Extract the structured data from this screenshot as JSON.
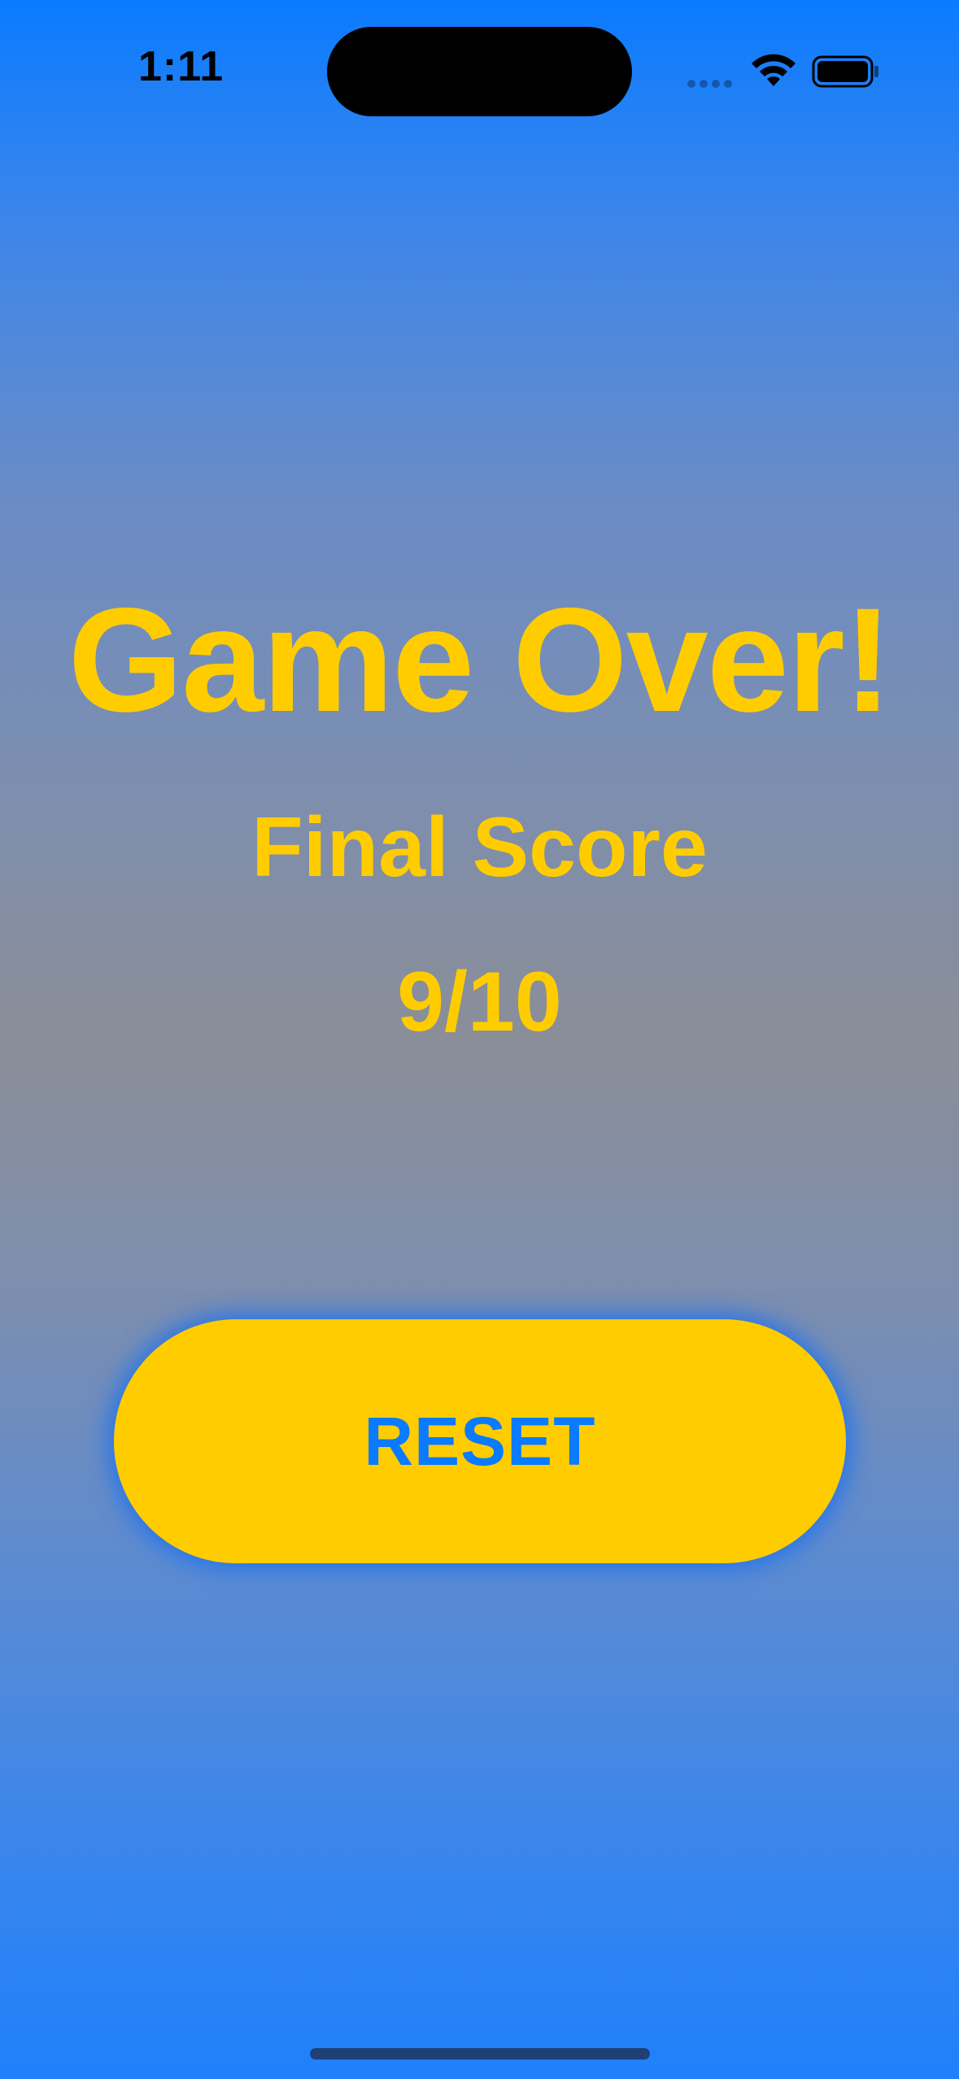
{
  "status_bar": {
    "time": "1:11"
  },
  "game_over": {
    "title": "Game Over!",
    "subtitle": "Final Score",
    "score": "9/10"
  },
  "actions": {
    "reset_label": "RESET"
  },
  "colors": {
    "accent_yellow": "#ffcc00",
    "accent_blue": "#0a7bff",
    "background_gray": "#8a8e97"
  },
  "icons": {
    "wifi": "wifi-icon",
    "battery": "battery-icon",
    "signal": "cellular-signal-icon"
  }
}
